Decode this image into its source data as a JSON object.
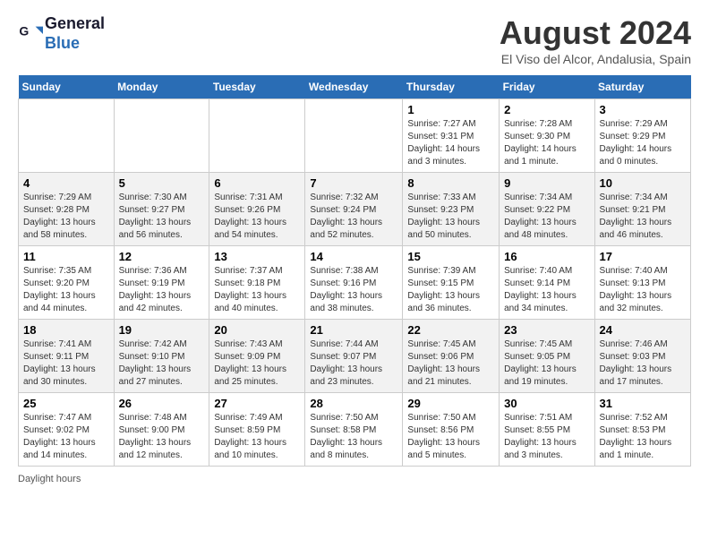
{
  "header": {
    "logo_line1": "General",
    "logo_line2": "Blue",
    "month_title": "August 2024",
    "location": "El Viso del Alcor, Andalusia, Spain"
  },
  "weekdays": [
    "Sunday",
    "Monday",
    "Tuesday",
    "Wednesday",
    "Thursday",
    "Friday",
    "Saturday"
  ],
  "weeks": [
    [
      {
        "day": "",
        "info": ""
      },
      {
        "day": "",
        "info": ""
      },
      {
        "day": "",
        "info": ""
      },
      {
        "day": "",
        "info": ""
      },
      {
        "day": "1",
        "info": "Sunrise: 7:27 AM\nSunset: 9:31 PM\nDaylight: 14 hours and 3 minutes."
      },
      {
        "day": "2",
        "info": "Sunrise: 7:28 AM\nSunset: 9:30 PM\nDaylight: 14 hours and 1 minute."
      },
      {
        "day": "3",
        "info": "Sunrise: 7:29 AM\nSunset: 9:29 PM\nDaylight: 14 hours and 0 minutes."
      }
    ],
    [
      {
        "day": "4",
        "info": "Sunrise: 7:29 AM\nSunset: 9:28 PM\nDaylight: 13 hours and 58 minutes."
      },
      {
        "day": "5",
        "info": "Sunrise: 7:30 AM\nSunset: 9:27 PM\nDaylight: 13 hours and 56 minutes."
      },
      {
        "day": "6",
        "info": "Sunrise: 7:31 AM\nSunset: 9:26 PM\nDaylight: 13 hours and 54 minutes."
      },
      {
        "day": "7",
        "info": "Sunrise: 7:32 AM\nSunset: 9:24 PM\nDaylight: 13 hours and 52 minutes."
      },
      {
        "day": "8",
        "info": "Sunrise: 7:33 AM\nSunset: 9:23 PM\nDaylight: 13 hours and 50 minutes."
      },
      {
        "day": "9",
        "info": "Sunrise: 7:34 AM\nSunset: 9:22 PM\nDaylight: 13 hours and 48 minutes."
      },
      {
        "day": "10",
        "info": "Sunrise: 7:34 AM\nSunset: 9:21 PM\nDaylight: 13 hours and 46 minutes."
      }
    ],
    [
      {
        "day": "11",
        "info": "Sunrise: 7:35 AM\nSunset: 9:20 PM\nDaylight: 13 hours and 44 minutes."
      },
      {
        "day": "12",
        "info": "Sunrise: 7:36 AM\nSunset: 9:19 PM\nDaylight: 13 hours and 42 minutes."
      },
      {
        "day": "13",
        "info": "Sunrise: 7:37 AM\nSunset: 9:18 PM\nDaylight: 13 hours and 40 minutes."
      },
      {
        "day": "14",
        "info": "Sunrise: 7:38 AM\nSunset: 9:16 PM\nDaylight: 13 hours and 38 minutes."
      },
      {
        "day": "15",
        "info": "Sunrise: 7:39 AM\nSunset: 9:15 PM\nDaylight: 13 hours and 36 minutes."
      },
      {
        "day": "16",
        "info": "Sunrise: 7:40 AM\nSunset: 9:14 PM\nDaylight: 13 hours and 34 minutes."
      },
      {
        "day": "17",
        "info": "Sunrise: 7:40 AM\nSunset: 9:13 PM\nDaylight: 13 hours and 32 minutes."
      }
    ],
    [
      {
        "day": "18",
        "info": "Sunrise: 7:41 AM\nSunset: 9:11 PM\nDaylight: 13 hours and 30 minutes."
      },
      {
        "day": "19",
        "info": "Sunrise: 7:42 AM\nSunset: 9:10 PM\nDaylight: 13 hours and 27 minutes."
      },
      {
        "day": "20",
        "info": "Sunrise: 7:43 AM\nSunset: 9:09 PM\nDaylight: 13 hours and 25 minutes."
      },
      {
        "day": "21",
        "info": "Sunrise: 7:44 AM\nSunset: 9:07 PM\nDaylight: 13 hours and 23 minutes."
      },
      {
        "day": "22",
        "info": "Sunrise: 7:45 AM\nSunset: 9:06 PM\nDaylight: 13 hours and 21 minutes."
      },
      {
        "day": "23",
        "info": "Sunrise: 7:45 AM\nSunset: 9:05 PM\nDaylight: 13 hours and 19 minutes."
      },
      {
        "day": "24",
        "info": "Sunrise: 7:46 AM\nSunset: 9:03 PM\nDaylight: 13 hours and 17 minutes."
      }
    ],
    [
      {
        "day": "25",
        "info": "Sunrise: 7:47 AM\nSunset: 9:02 PM\nDaylight: 13 hours and 14 minutes."
      },
      {
        "day": "26",
        "info": "Sunrise: 7:48 AM\nSunset: 9:00 PM\nDaylight: 13 hours and 12 minutes."
      },
      {
        "day": "27",
        "info": "Sunrise: 7:49 AM\nSunset: 8:59 PM\nDaylight: 13 hours and 10 minutes."
      },
      {
        "day": "28",
        "info": "Sunrise: 7:50 AM\nSunset: 8:58 PM\nDaylight: 13 hours and 8 minutes."
      },
      {
        "day": "29",
        "info": "Sunrise: 7:50 AM\nSunset: 8:56 PM\nDaylight: 13 hours and 5 minutes."
      },
      {
        "day": "30",
        "info": "Sunrise: 7:51 AM\nSunset: 8:55 PM\nDaylight: 13 hours and 3 minutes."
      },
      {
        "day": "31",
        "info": "Sunrise: 7:52 AM\nSunset: 8:53 PM\nDaylight: 13 hours and 1 minute."
      }
    ]
  ],
  "footer": {
    "note": "Daylight hours"
  }
}
